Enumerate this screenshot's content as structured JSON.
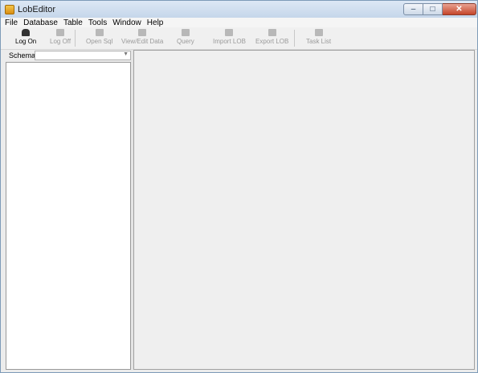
{
  "window": {
    "title": "LobEditor"
  },
  "window_controls": {
    "minimize": "–",
    "maximize": "□",
    "close": "✕"
  },
  "menu": [
    "File",
    "Database",
    "Table",
    "Tools",
    "Window",
    "Help"
  ],
  "toolbar": [
    {
      "label": "Log On",
      "enabled": true,
      "icon": "user-logon-icon"
    },
    {
      "label": "Log Off",
      "enabled": false,
      "icon": "user-logoff-icon"
    },
    {
      "label": "Open Sql",
      "enabled": false,
      "icon": "folder-open-icon"
    },
    {
      "label": "View/Edit Data",
      "enabled": false,
      "icon": "edit-data-icon"
    },
    {
      "label": "Query",
      "enabled": false,
      "icon": "query-icon"
    },
    {
      "label": "Import LOB",
      "enabled": false,
      "icon": "import-icon"
    },
    {
      "label": "Export LOB",
      "enabled": false,
      "icon": "export-icon"
    },
    {
      "label": "Task List",
      "enabled": false,
      "icon": "task-list-icon"
    }
  ],
  "schema": {
    "label": "Schema",
    "value": ""
  }
}
